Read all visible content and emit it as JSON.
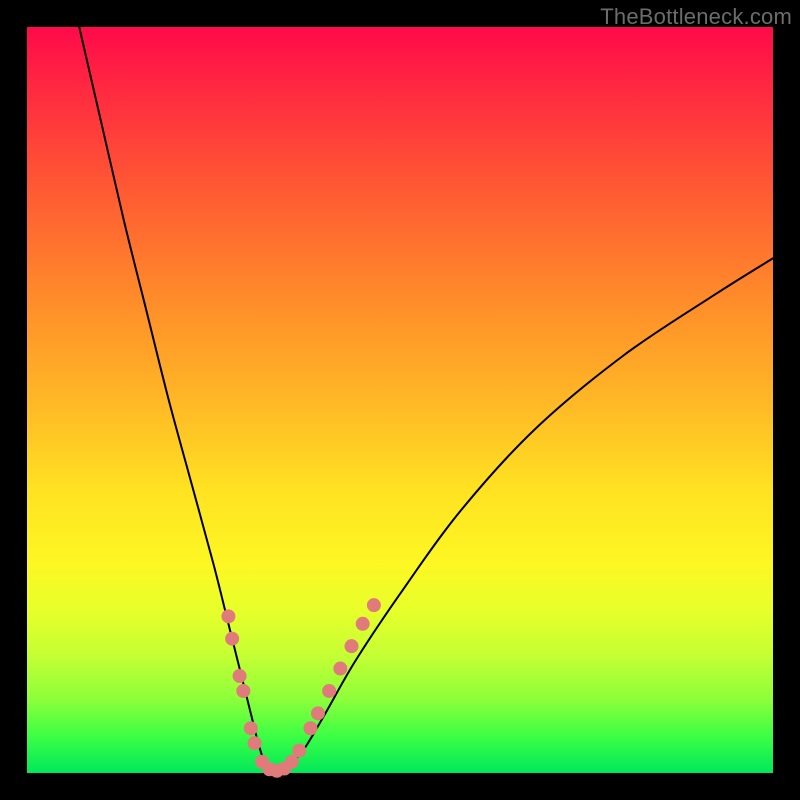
{
  "watermark": "TheBottleneck.com",
  "chart_data": {
    "type": "line",
    "title": "",
    "xlabel": "",
    "ylabel": "",
    "xlim": [
      0,
      100
    ],
    "ylim": [
      0,
      100
    ],
    "grid": false,
    "legend": false,
    "background_gradient": {
      "direction": "vertical",
      "stops": [
        {
          "pos": 0,
          "color": "#ff0a4a"
        },
        {
          "pos": 50,
          "color": "#ffb726"
        },
        {
          "pos": 75,
          "color": "#fdf723"
        },
        {
          "pos": 100,
          "color": "#00e85a"
        }
      ]
    },
    "series": [
      {
        "name": "bottleneck-curve",
        "color": "#000000",
        "stroke_width": 2,
        "x": [
          7,
          10,
          13,
          16,
          19,
          22,
          25,
          27,
          29,
          30,
          31,
          32,
          33,
          34,
          35,
          37,
          40,
          44,
          50,
          58,
          68,
          80,
          92,
          100
        ],
        "values": [
          100,
          87,
          74,
          62,
          50,
          39,
          28,
          20,
          12,
          8,
          4,
          1,
          0,
          0,
          1,
          3,
          8,
          15,
          24,
          35,
          46,
          56,
          64,
          69
        ]
      }
    ],
    "markers": {
      "name": "highlight-dots",
      "color": "#e17a7a",
      "radius": 7,
      "points": [
        {
          "x": 27.0,
          "y": 21
        },
        {
          "x": 27.5,
          "y": 18
        },
        {
          "x": 28.5,
          "y": 13
        },
        {
          "x": 29.0,
          "y": 11
        },
        {
          "x": 30.0,
          "y": 6
        },
        {
          "x": 30.5,
          "y": 4
        },
        {
          "x": 31.5,
          "y": 1.5
        },
        {
          "x": 32.5,
          "y": 0.5
        },
        {
          "x": 33.5,
          "y": 0.3
        },
        {
          "x": 34.5,
          "y": 0.6
        },
        {
          "x": 35.5,
          "y": 1.5
        },
        {
          "x": 36.5,
          "y": 3
        },
        {
          "x": 38.0,
          "y": 6
        },
        {
          "x": 39.0,
          "y": 8
        },
        {
          "x": 40.5,
          "y": 11
        },
        {
          "x": 42.0,
          "y": 14
        },
        {
          "x": 43.5,
          "y": 17
        },
        {
          "x": 45.0,
          "y": 20
        },
        {
          "x": 46.5,
          "y": 22.5
        }
      ]
    }
  }
}
